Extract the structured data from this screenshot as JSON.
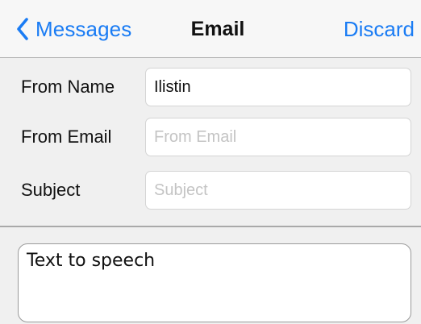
{
  "navbar": {
    "back_label": "Messages",
    "title": "Email",
    "discard_label": "Discard",
    "back_icon": "chevron-left-icon",
    "accent_color": "#1a7cf4"
  },
  "form": {
    "from_name": {
      "label": "From Name",
      "value": "Ilistin",
      "placeholder": "From Name"
    },
    "from_email": {
      "label": "From Email",
      "value": "",
      "placeholder": "From Email"
    },
    "subject": {
      "label": "Subject",
      "value": "",
      "placeholder": "Subject"
    }
  },
  "body": {
    "text": "Text to speech"
  }
}
